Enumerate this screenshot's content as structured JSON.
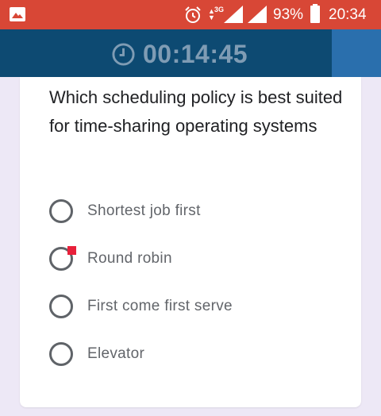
{
  "status_bar": {
    "network_type": "3G",
    "battery_percent": "93%",
    "time": "20:34",
    "icons": [
      "gallery-icon",
      "alarm-icon",
      "network-arrows-icon",
      "signal-icon",
      "signal-icon",
      "battery-icon"
    ]
  },
  "timer": {
    "icon": "clock-icon",
    "value": "00:14:45"
  },
  "question": {
    "text": "Which scheduling policy is best suited for time-sharing operating systems"
  },
  "options": [
    {
      "label": "Shortest job first",
      "selected": false
    },
    {
      "label": "Round robin",
      "selected": false,
      "marked": true
    },
    {
      "label": "First come first serve",
      "selected": false
    },
    {
      "label": "Elevator",
      "selected": false
    }
  ],
  "colors": {
    "status_bar": "#d84736",
    "timer_bar": "#0d4a72",
    "timer_accent": "#2a6fad",
    "background": "#ede8f6",
    "marker": "#e8203a"
  }
}
